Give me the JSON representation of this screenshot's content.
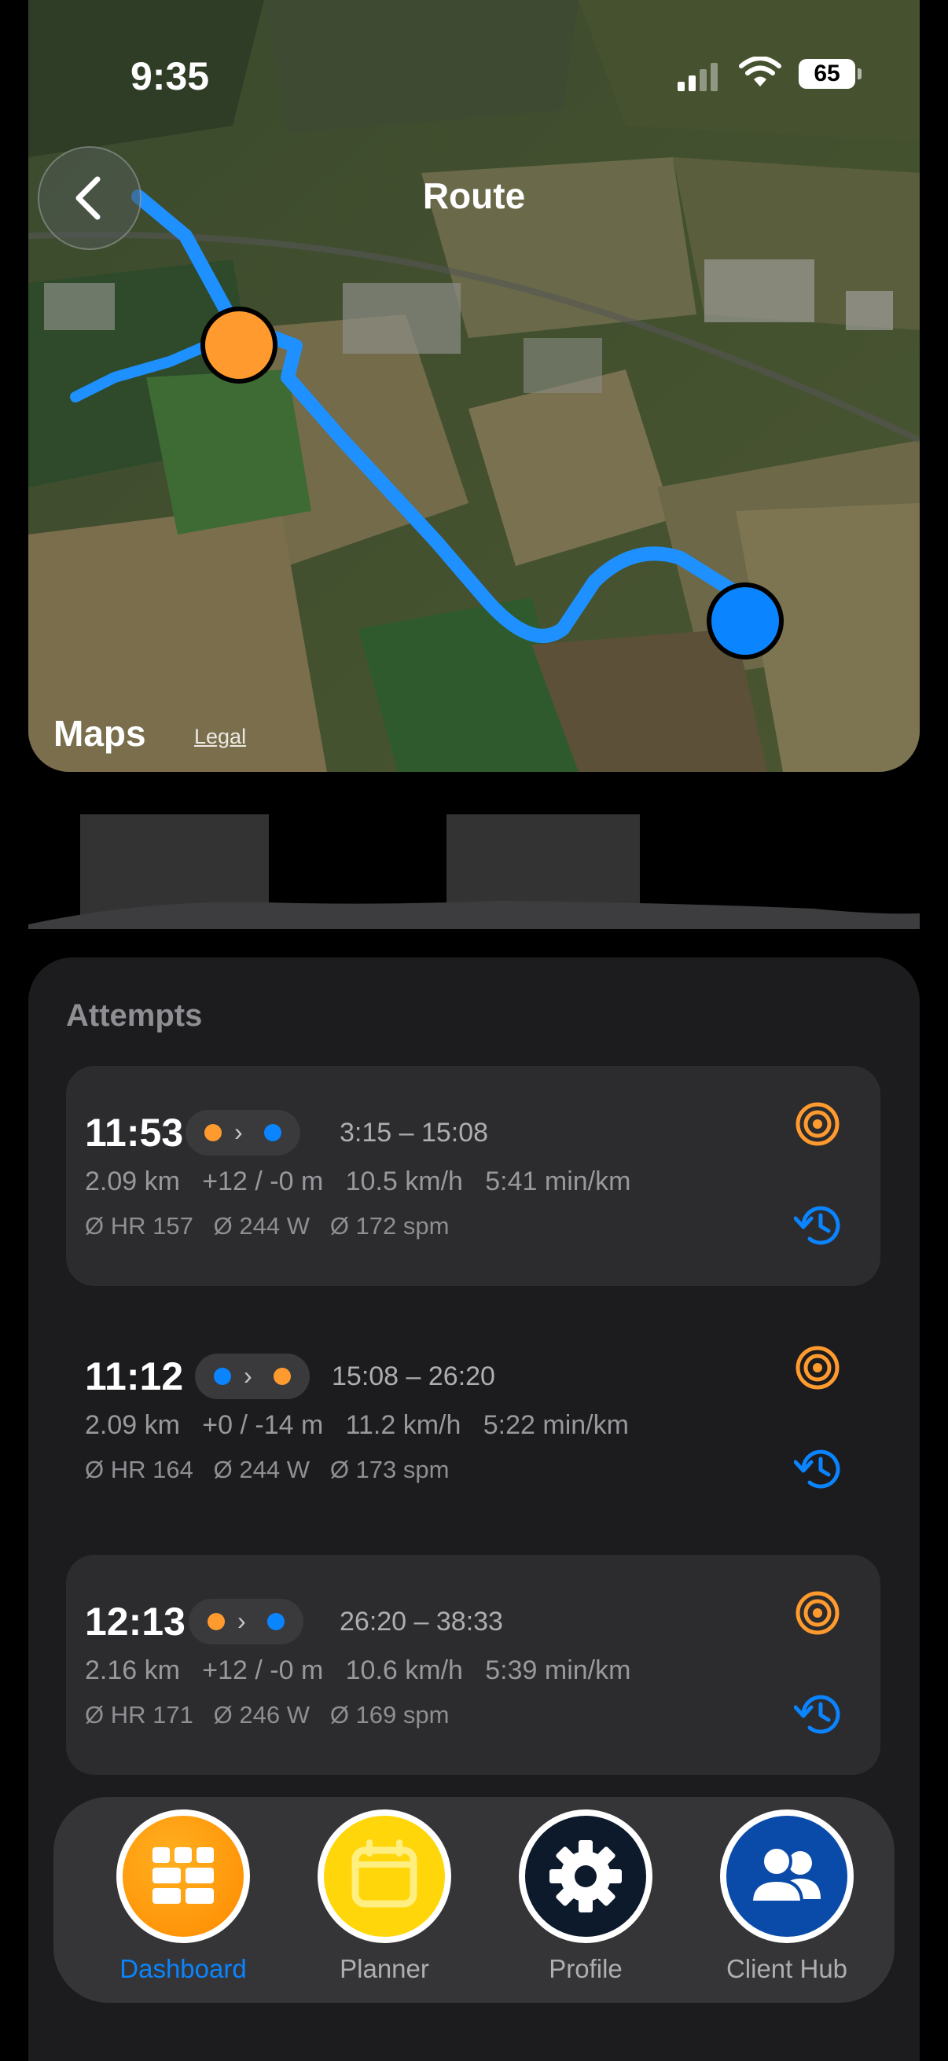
{
  "status_bar": {
    "time": "9:35",
    "battery": "65"
  },
  "header": {
    "title": "Route"
  },
  "map": {
    "attribution_brand": "Maps",
    "legal_link": "Legal",
    "start_color": "#ff9a2e",
    "end_color": "#0a84ff",
    "route_color": "#1e90ff"
  },
  "attempts": {
    "title": "Attempts",
    "items": [
      {
        "time": "11:53",
        "from": "orange",
        "to": "blue",
        "range": "3:15 – 15:08",
        "stats": "2.09 km   +12 / -0 m   10.5 km/h   5:41 min/km",
        "sensors": "Ø HR 157   Ø 244 W   Ø 172 spm",
        "highlighted": true
      },
      {
        "time": "11:12",
        "from": "blue",
        "to": "orange",
        "range": "15:08 – 26:20",
        "stats": "2.09 km   +0 / -14 m   11.2 km/h   5:22 min/km",
        "sensors": "Ø HR 164   Ø 244 W   Ø 173 spm",
        "highlighted": false
      },
      {
        "time": "12:13",
        "from": "orange",
        "to": "blue",
        "range": "26:20 – 38:33",
        "stats": "2.16 km   +12 / -0 m   10.6 km/h   5:39 min/km",
        "sensors": "Ø HR 171   Ø 246 W   Ø 169 spm",
        "highlighted": true
      }
    ]
  },
  "tabbar": {
    "tabs": [
      {
        "label": "Dashboard",
        "icon": "grid-icon",
        "active": true
      },
      {
        "label": "Planner",
        "icon": "calendar-icon",
        "active": false
      },
      {
        "label": "Profile",
        "icon": "gear-icon",
        "active": false
      },
      {
        "label": "Client Hub",
        "icon": "people-icon",
        "active": false
      }
    ]
  }
}
